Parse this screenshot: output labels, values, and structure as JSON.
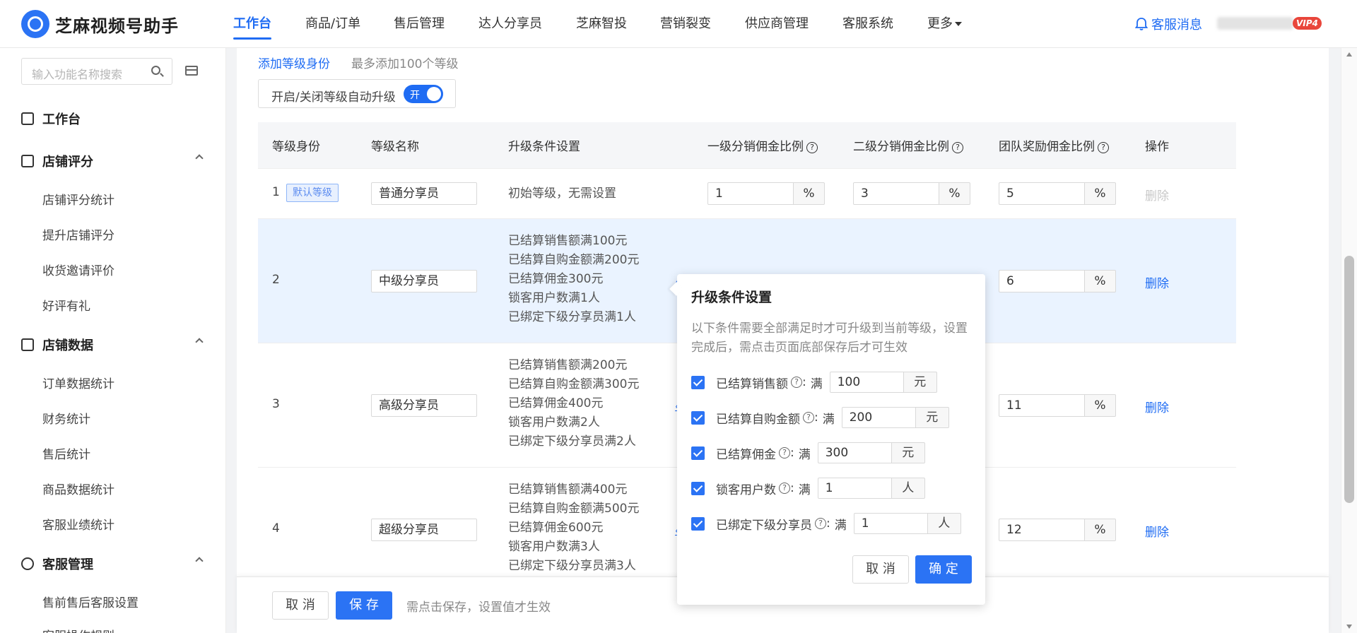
{
  "app": {
    "name": "芝麻视频号助手"
  },
  "topnav": [
    {
      "label": "工作台"
    },
    {
      "label": "商品/订单"
    },
    {
      "label": "售后管理"
    },
    {
      "label": "达人分享员"
    },
    {
      "label": "芝麻智投"
    },
    {
      "label": "营销裂变"
    },
    {
      "label": "供应商管理"
    },
    {
      "label": "客服系统"
    },
    {
      "label": "更多"
    }
  ],
  "header": {
    "messages_label": "客服消息",
    "vip_label": "VIP4"
  },
  "sidebar": {
    "search_placeholder": "输入功能名称搜索",
    "top_item": "工作台",
    "groups": [
      {
        "label": "店铺评分",
        "items": [
          "店铺评分统计",
          "提升店铺评分",
          "收货邀请评价",
          "好评有礼"
        ]
      },
      {
        "label": "店铺数据",
        "items": [
          "订单数据统计",
          "财务统计",
          "售后统计",
          "商品数据统计",
          "客服业绩统计"
        ]
      },
      {
        "label": "客服管理",
        "items": [
          "售前售后客服设置",
          "客服操作规则"
        ]
      }
    ]
  },
  "main": {
    "add_level": "添加等级身份",
    "max_hint": "最多添加100个等级",
    "auto_upgrade_label": "开启/关闭等级自动升级",
    "toggle_text": "开",
    "columns": [
      "等级身份",
      "等级名称",
      "升级条件设置",
      "一级分销佣金比例",
      "二级分销佣金比例",
      "团队奖励佣金比例",
      "操作"
    ],
    "default_badge": "默认等级",
    "rows": [
      {
        "num": "1",
        "name": "普通分享员",
        "conditions": [
          "初始等级，无需设置"
        ],
        "rate1": "1",
        "rate2": "3",
        "rate3": "5",
        "action": "删除"
      },
      {
        "num": "2",
        "name": "中级分享员",
        "conditions": [
          "已结算销售额满100元",
          "已结算自购金额满200元",
          "已结算佣金300元",
          "锁客用户数满1人",
          "已绑定下级分享员满1人"
        ],
        "rate3": "6",
        "action": "删除"
      },
      {
        "num": "3",
        "name": "高级分享员",
        "conditions": [
          "已结算销售额满200元",
          "已结算自购金额满300元",
          "已结算佣金400元",
          "锁客用户数满2人",
          "已绑定下级分享员满2人"
        ],
        "rate3": "11",
        "action": "删除"
      },
      {
        "num": "4",
        "name": "超级分享员",
        "conditions": [
          "已结算销售额满400元",
          "已结算自购金额满500元",
          "已结算佣金600元",
          "锁客用户数满3人",
          "已绑定下级分享员满3人"
        ],
        "rate3": "12",
        "action": "删除"
      }
    ],
    "pct_suffix": "%"
  },
  "footer": {
    "cancel": "取 消",
    "save": "保 存",
    "hint": "需点击保存，设置值才生效"
  },
  "popover": {
    "title": "升级条件设置",
    "desc": "以下条件需要全部满足时才可升级到当前等级，设置完成后，需点击页面底部保存后才可生效",
    "full_label": "满",
    "conditions": [
      {
        "label": "已结算销售额",
        "value": "100",
        "unit": "元"
      },
      {
        "label": "已结算自购金额",
        "value": "200",
        "unit": "元"
      },
      {
        "label": "已结算佣金",
        "value": "300",
        "unit": "元"
      },
      {
        "label": "锁客用户数",
        "value": "1",
        "unit": "人"
      },
      {
        "label": "已绑定下级分享员",
        "value": "1",
        "unit": "人"
      }
    ],
    "cancel": "取 消",
    "confirm": "确 定"
  },
  "colors": {
    "primary": "#2b73f4",
    "highlight_row": "#eaf3ff",
    "badge_bg": "#e8f0fe"
  }
}
